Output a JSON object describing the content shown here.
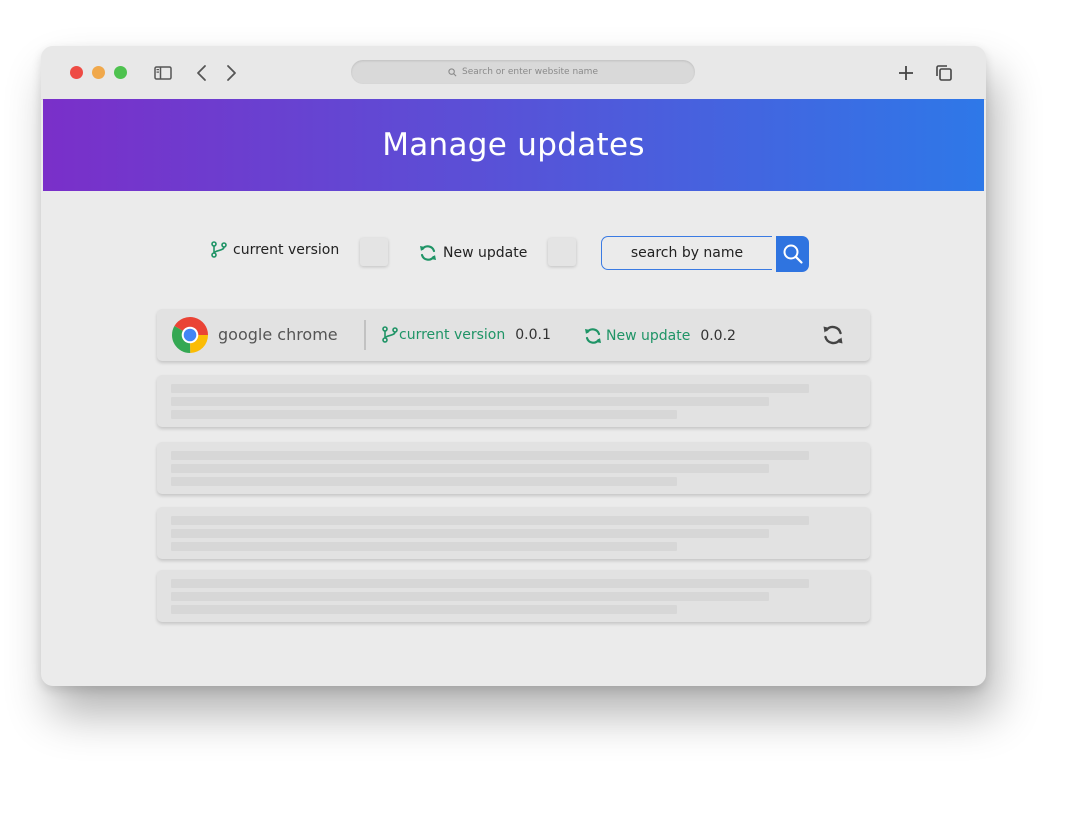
{
  "browser": {
    "address_bar_placeholder": "Search or enter website name",
    "traffic_lights": {
      "close": "#ee4b44",
      "minimize": "#f0a84b",
      "zoom": "#4ec24f"
    }
  },
  "header": {
    "title": "Manage updates",
    "gradient": [
      "#7a2fc9",
      "#2e78e8"
    ]
  },
  "filters": {
    "current_version_label": "current version",
    "current_version_checked": false,
    "new_update_label": "New update",
    "new_update_checked": false,
    "search_placeholder": "search by name"
  },
  "apps": [
    {
      "name": "google chrome",
      "icon": "chrome-logo",
      "current_version_label": "current version",
      "current_version": "0.0.1",
      "new_update_label": "New update",
      "new_update": "0.0.2"
    }
  ],
  "accent_colors": {
    "version_green": "#1f9466",
    "search_blue": "#2f74e0"
  }
}
